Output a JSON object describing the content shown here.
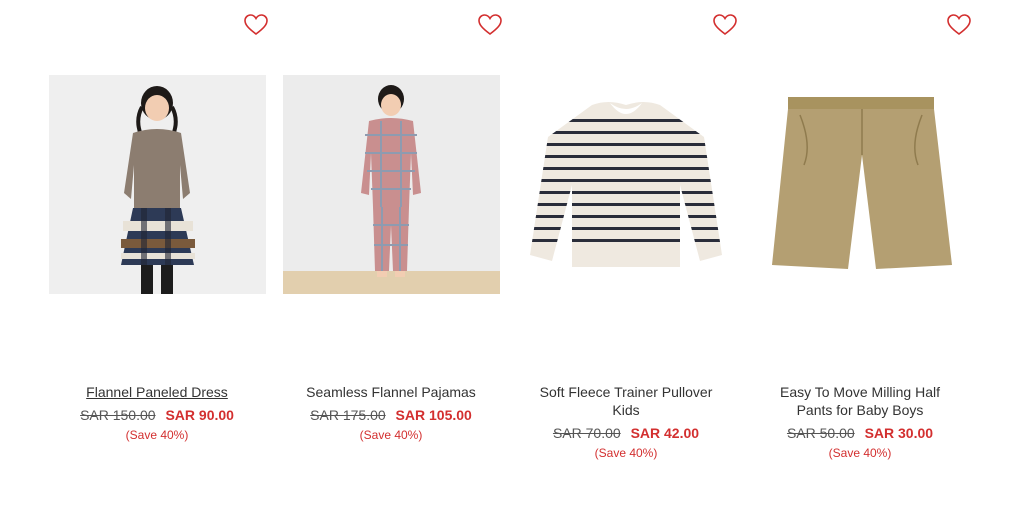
{
  "products": [
    {
      "name": "Flannel Paneled Dress",
      "old_price": "SAR  150.00",
      "new_price": "SAR  90.00",
      "save": "(Save 40%)",
      "icon": "heart-icon"
    },
    {
      "name": "Seamless Flannel Pajamas",
      "old_price": "SAR  175.00",
      "new_price": "SAR  105.00",
      "save": "(Save 40%)",
      "icon": "heart-icon"
    },
    {
      "name": "Soft Fleece Trainer Pullover Kids",
      "old_price": "SAR  70.00",
      "new_price": "SAR  42.00",
      "save": "(Save 40%)",
      "icon": "heart-icon"
    },
    {
      "name": "Easy To Move Milling Half Pants for Baby Boys",
      "old_price": "SAR  50.00",
      "new_price": "SAR  30.00",
      "save": "(Save 40%)",
      "icon": "heart-icon"
    }
  ],
  "colors": {
    "accent": "#d32f2f",
    "text": "#333333"
  }
}
